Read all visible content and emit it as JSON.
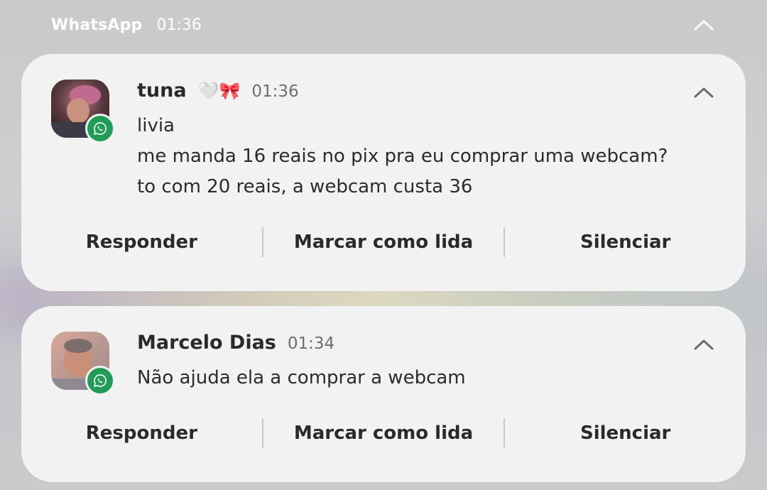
{
  "group": {
    "app_name": "WhatsApp",
    "time": "01:36"
  },
  "notifications": [
    {
      "sender": "tuna",
      "sender_emoji": "🤍🎀",
      "time": "01:36",
      "lines": [
        "livia",
        "me manda 16 reais no pix pra eu comprar uma webcam?",
        "to com 20 reais, a webcam custa 36"
      ],
      "actions": [
        "Responder",
        "Marcar como lida",
        "Silenciar"
      ]
    },
    {
      "sender": "Marcelo Dias",
      "time": "01:34",
      "lines": [
        "Não ajuda ela a comprar a webcam"
      ],
      "actions": [
        "Responder",
        "Marcar como lida",
        "Silenciar"
      ]
    }
  ],
  "icons": {
    "badge": "whatsapp-icon",
    "collapse": "chevron-up-icon"
  },
  "colors": {
    "whatsapp_green": "#1f9d55",
    "card_bg": "#f2f2f3"
  }
}
